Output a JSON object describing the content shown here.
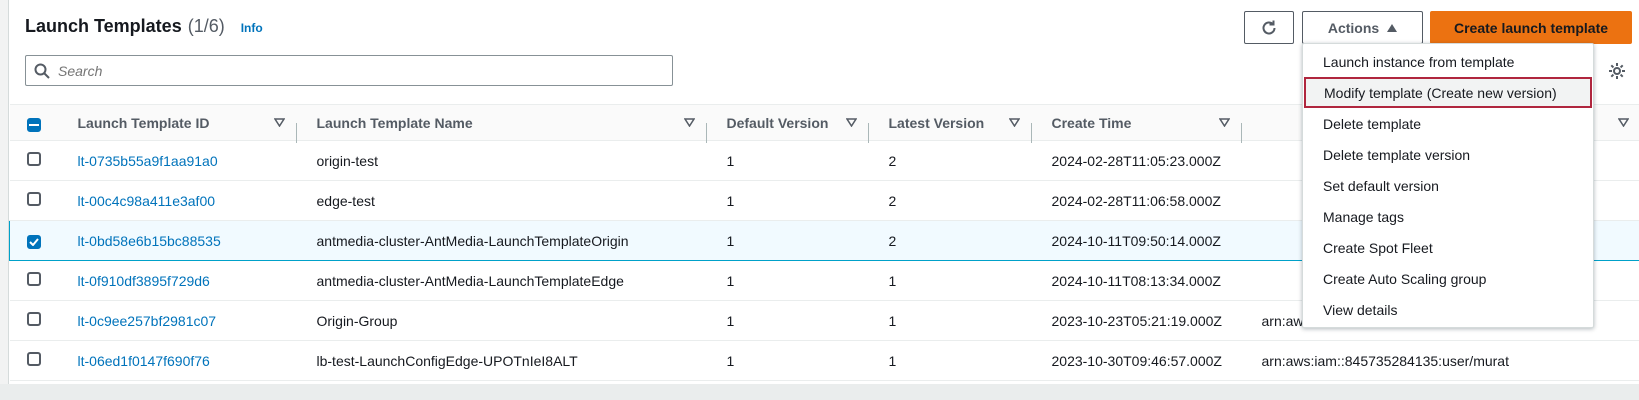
{
  "header": {
    "title": "Launch Templates",
    "count": "(1/6)",
    "info": "Info"
  },
  "toolbar": {
    "actions_label": "Actions",
    "create_label": "Create launch template"
  },
  "search": {
    "placeholder": "Search"
  },
  "columns": [
    "Launch Template ID",
    "Launch Template Name",
    "Default Version",
    "Latest Version",
    "Create Time"
  ],
  "rows": [
    {
      "id": "lt-0735b55a9f1aa91a0",
      "name": "origin-test",
      "default": "1",
      "latest": "2",
      "created": "2024-02-28T11:05:23.000Z",
      "owner": "",
      "checked": false
    },
    {
      "id": "lt-00c4c98a411e3af00",
      "name": "edge-test",
      "default": "1",
      "latest": "2",
      "created": "2024-02-28T11:06:58.000Z",
      "owner": "",
      "checked": false
    },
    {
      "id": "lt-0bd58e6b15bc88535",
      "name": "antmedia-cluster-AntMedia-LaunchTemplateOrigin",
      "default": "1",
      "latest": "2",
      "created": "2024-10-11T09:50:14.000Z",
      "owner": "",
      "checked": true
    },
    {
      "id": "lt-0f910df3895f729d6",
      "name": "antmedia-cluster-AntMedia-LaunchTemplateEdge",
      "default": "1",
      "latest": "1",
      "created": "2024-10-11T08:13:34.000Z",
      "owner": "",
      "checked": false
    },
    {
      "id": "lt-0c9ee257bf2981c07",
      "name": "Origin-Group",
      "default": "1",
      "latest": "1",
      "created": "2023-10-23T05:21:19.000Z",
      "owner": "arn:aws:iam::845735284135:user/murat",
      "checked": false
    },
    {
      "id": "lt-06ed1f0147f690f76",
      "name": "lb-test-LaunchConfigEdge-UPOTnIeI8ALT",
      "default": "1",
      "latest": "1",
      "created": "2023-10-30T09:46:57.000Z",
      "owner": "arn:aws:iam::845735284135:user/murat",
      "checked": false
    }
  ],
  "actions_menu": [
    "Launch instance from template",
    "Modify template (Create new version)",
    "Delete template",
    "Delete template version",
    "Set default version",
    "Manage tags",
    "Create Spot Fleet",
    "Create Auto Scaling group",
    "View details"
  ],
  "colors": {
    "accent": "#ec7211",
    "link": "#0073bb",
    "highlight_border": "#b0263e"
  }
}
